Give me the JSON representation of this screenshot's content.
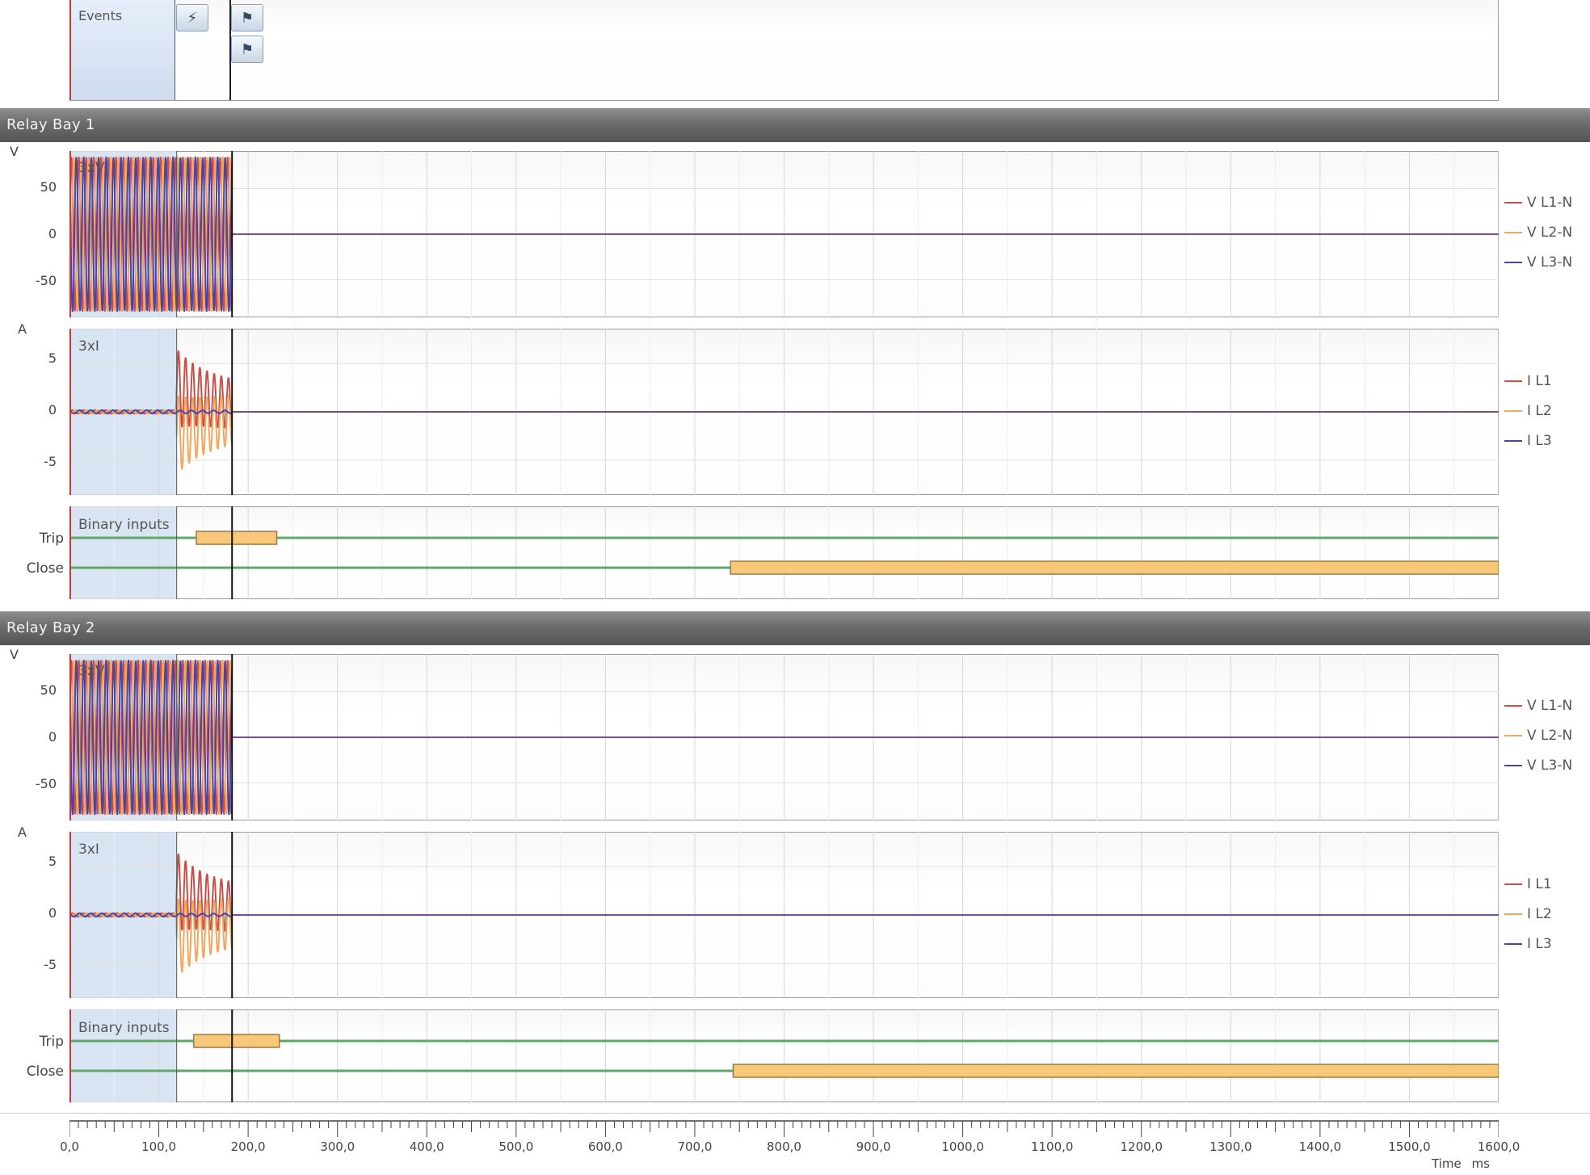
{
  "events_panel": {
    "label": "Events",
    "icons": [
      "lightning-icon",
      "flag-icon",
      "flag-icon"
    ]
  },
  "relay_bays": [
    {
      "title": "Relay Bay 1",
      "voltage": {
        "unit": "V",
        "tag": "3xV",
        "ticks": [
          "50",
          "0",
          "-50"
        ],
        "legend": [
          "V L1-N",
          "V L2-N",
          "V L3-N"
        ]
      },
      "current": {
        "unit": "A",
        "tag": "3xI",
        "ticks": [
          "5",
          "0",
          "-5"
        ],
        "legend": [
          "I L1",
          "I L2",
          "I L3"
        ]
      },
      "binary": {
        "tag": "Binary inputs",
        "signals": [
          "Trip",
          "Close"
        ]
      }
    },
    {
      "title": "Relay Bay 2",
      "voltage": {
        "unit": "V",
        "tag": "3xV",
        "ticks": [
          "50",
          "0",
          "-50"
        ],
        "legend": [
          "V L1-N",
          "V L2-N",
          "V L3-N"
        ]
      },
      "current": {
        "unit": "A",
        "tag": "3xI",
        "ticks": [
          "5",
          "0",
          "-5"
        ],
        "legend": [
          "I L1",
          "I L2",
          "I L3"
        ]
      },
      "binary": {
        "tag": "Binary inputs",
        "signals": [
          "Trip",
          "Close"
        ]
      }
    }
  ],
  "time_axis": {
    "ticks": [
      "0,0",
      "100,0",
      "200,0",
      "300,0",
      "400,0",
      "500,0",
      "600,0",
      "700,0",
      "800,0",
      "900,0",
      "1000,0",
      "1100,0",
      "1200,0",
      "1300,0",
      "1400,0",
      "1500,0",
      "1600,0"
    ],
    "label": "Time",
    "unit": "ms"
  },
  "colors": {
    "L1": "#c8504a",
    "L2": "#f0a860",
    "L3": "#4a44a8",
    "binary_line": "#5fa86a",
    "binary_active": "#f7c87a"
  },
  "chart_data": {
    "type": "line",
    "x_unit": "ms",
    "xlim": [
      0,
      1600
    ],
    "prefault_end_ms": 120,
    "cursor_ms": 182,
    "voltage_amplitude_V": 85,
    "voltage_ylim": [
      -85,
      85
    ],
    "current_ylim": [
      -8,
      8
    ],
    "current_peak_A": 7.5,
    "current_steady_A": 4.5,
    "frequency_hz": 50,
    "binary_events": [
      {
        "bay": 1,
        "signal": "Trip",
        "on_ms": 142,
        "off_ms": 232
      },
      {
        "bay": 1,
        "signal": "Close",
        "on_ms": 740,
        "off_ms": 1600
      },
      {
        "bay": 2,
        "signal": "Trip",
        "on_ms": 139,
        "off_ms": 235
      },
      {
        "bay": 2,
        "signal": "Close",
        "on_ms": 743,
        "off_ms": 1600
      }
    ]
  }
}
